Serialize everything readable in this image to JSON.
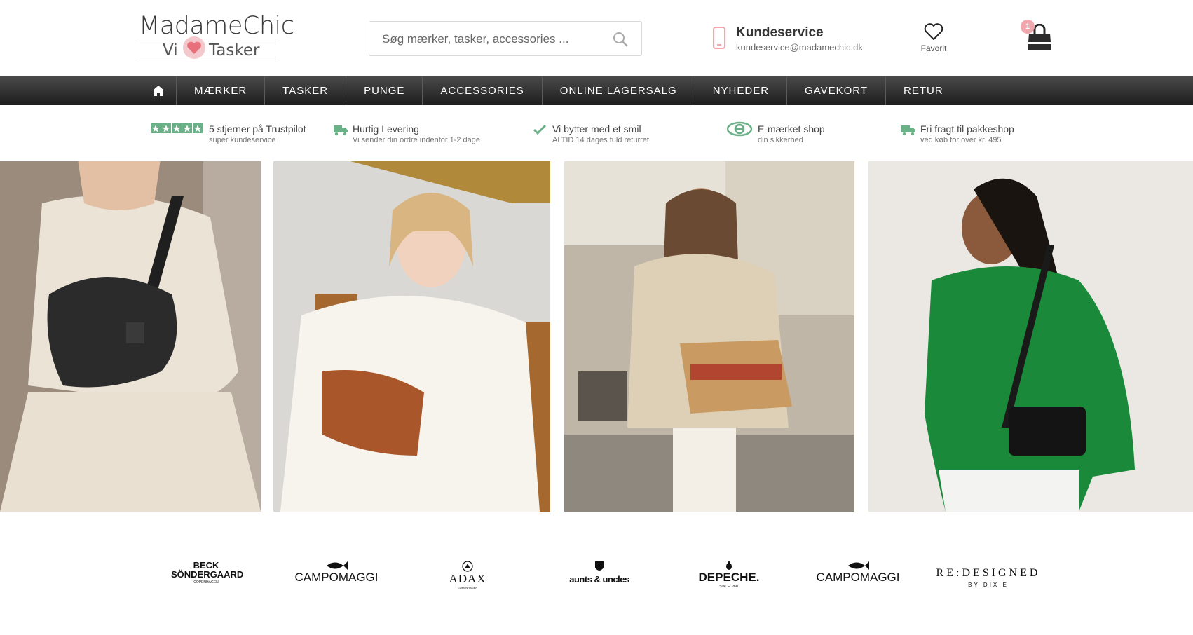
{
  "header": {
    "logo": {
      "name": "MadameChic",
      "tagline_left": "Vi",
      "tagline_right": "Tasker"
    },
    "search": {
      "placeholder": "Søg mærker, tasker, accessories ..."
    },
    "service": {
      "title": "Kundeservice",
      "email": "kundeservice@madamechic.dk"
    },
    "favorite_label": "Favorit",
    "cart_count": "1"
  },
  "nav": {
    "items": [
      {
        "label": "MÆRKER"
      },
      {
        "label": "TASKER"
      },
      {
        "label": "PUNGE"
      },
      {
        "label": "ACCESSORIES"
      },
      {
        "label": "ONLINE LAGERSALG"
      },
      {
        "label": "NYHEDER"
      },
      {
        "label": "GAVEKORT"
      },
      {
        "label": "RETUR"
      }
    ]
  },
  "usps": [
    {
      "title": "5 stjerner på Trustpilot",
      "subtitle": "super kundeservice",
      "icon": "trustpilot-stars-icon"
    },
    {
      "title": "Hurtig Levering",
      "subtitle": "Vi sender din ordre indenfor 1-2 dage",
      "icon": "truck-icon"
    },
    {
      "title": "Vi bytter med et smil",
      "subtitle": "ALTID 14 dages fuld returret",
      "icon": "checkmark-icon"
    },
    {
      "title": "E-mærket shop",
      "subtitle": "din sikkerhed",
      "icon": "e-maerket-icon"
    },
    {
      "title": "Fri fragt til pakkeshop",
      "subtitle": "ved køb for over kr. 495",
      "icon": "truck-icon"
    }
  ],
  "brands": [
    {
      "line1": "BECK",
      "line2": "SÖNDERGAARD",
      "line3": "COPENHAGEN"
    },
    {
      "line1": "CAMPOMAGGI"
    },
    {
      "line1": "ADAX",
      "line2": "COPENHAGEN"
    },
    {
      "line1": "aunts & uncles"
    },
    {
      "line1": "DEPECHE.",
      "line2": "SINCE 1891"
    },
    {
      "line1": "CAMPOMAGGI"
    },
    {
      "line1": "RE:DESIGNED",
      "line2": "BY DIXIE"
    }
  ],
  "colors": {
    "accent_pink": "#f1a7ae",
    "usp_green": "#6ab187",
    "nav_dark": "#2a2a2a"
  }
}
